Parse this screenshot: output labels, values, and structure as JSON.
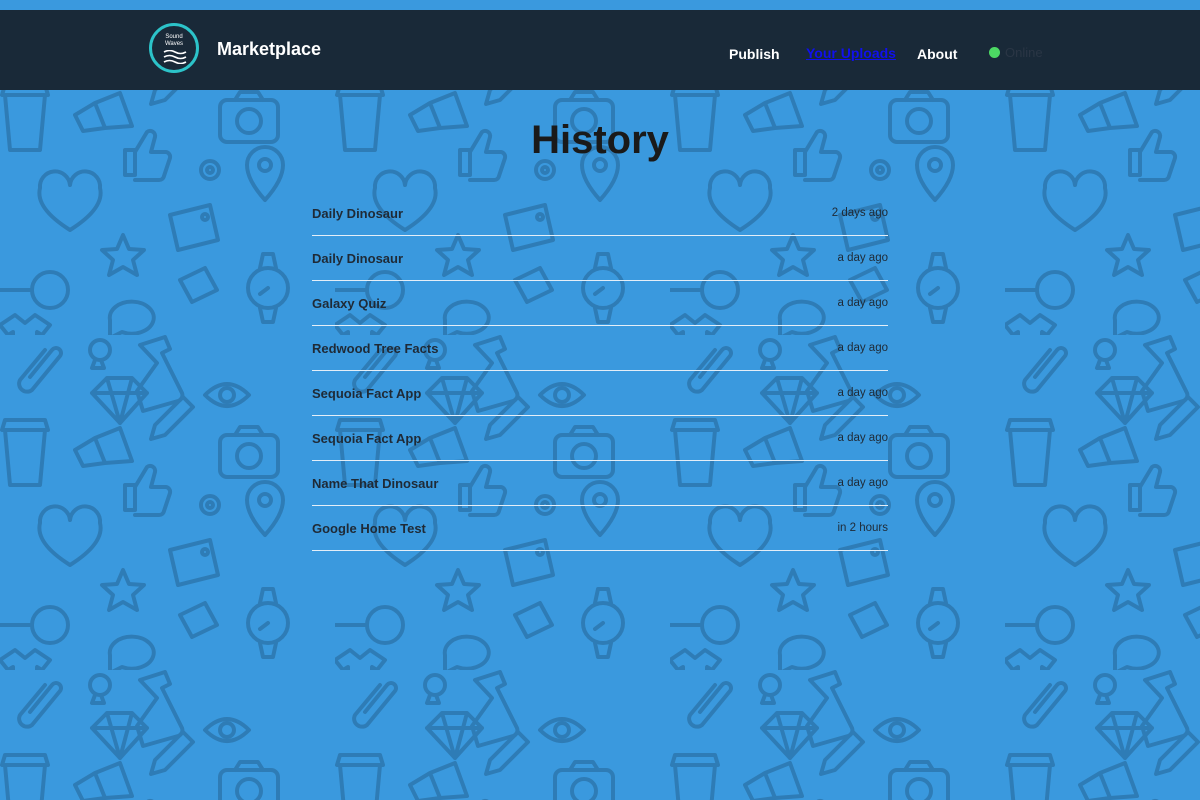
{
  "navbar": {
    "logo_line1": "Sound",
    "logo_line2": "Waves",
    "brand": "Marketplace",
    "links": {
      "publish": "Publish",
      "uploads": "Your Uploads",
      "about": "About"
    },
    "status": "Online",
    "status_color": "#4cd964"
  },
  "page": {
    "title": "History"
  },
  "history": [
    {
      "name": "Daily Dinosaur",
      "time": "2 days ago"
    },
    {
      "name": "Daily Dinosaur",
      "time": "a day ago"
    },
    {
      "name": "Galaxy Quiz",
      "time": "a day ago"
    },
    {
      "name": "Redwood Tree Facts",
      "time": "a day ago"
    },
    {
      "name": "Sequoia Fact App",
      "time": "a day ago"
    },
    {
      "name": "Sequoia Fact App",
      "time": "a day ago"
    },
    {
      "name": "Name That Dinosaur",
      "time": "a day ago"
    },
    {
      "name": "Google Home Test",
      "time": "in 2 hours"
    }
  ],
  "colors": {
    "background": "#3a99de",
    "navbar": "#192938",
    "logo_ring": "#2cc3c9",
    "active_link": "#1010ee"
  }
}
